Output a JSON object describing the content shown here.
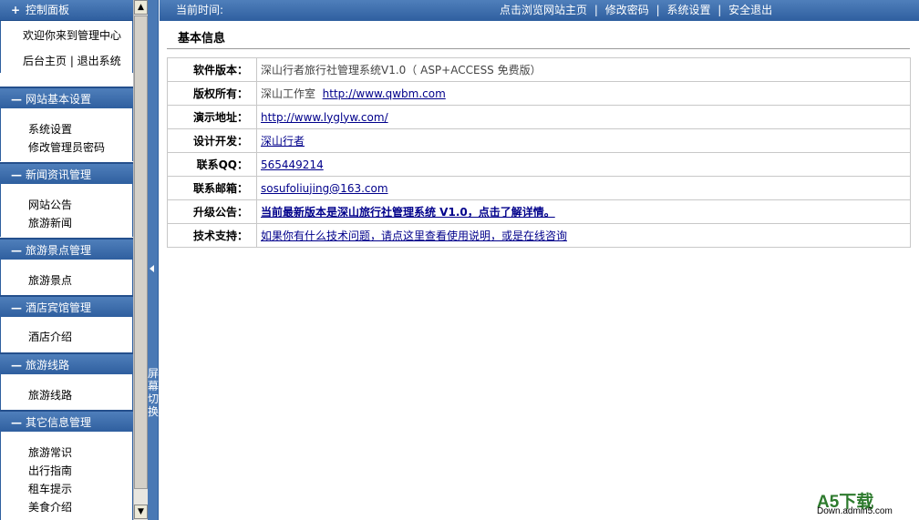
{
  "sidebar": {
    "control_panel": {
      "title": "控制面板",
      "icon": "plus-icon",
      "links": [
        "欢迎你来到管理中心",
        "后台主页 | 退出系统"
      ]
    },
    "sections": [
      {
        "title": "网站基本设置",
        "icon": "minus-icon",
        "items": [
          "系统设置",
          "修改管理员密码"
        ]
      },
      {
        "title": "新闻资讯管理",
        "icon": "minus-icon",
        "items": [
          "网站公告",
          "旅游新闻"
        ]
      },
      {
        "title": "旅游景点管理",
        "icon": "minus-icon",
        "items": [
          "旅游景点"
        ]
      },
      {
        "title": "酒店宾馆管理",
        "icon": "minus-icon",
        "items": [
          "酒店介绍"
        ]
      },
      {
        "title": "旅游线路",
        "icon": "minus-icon",
        "items": [
          "旅游线路"
        ]
      },
      {
        "title": "其它信息管理",
        "icon": "minus-icon",
        "items": [
          "旅游常识",
          "出行指南",
          "租车提示",
          "美食介绍"
        ]
      }
    ]
  },
  "splitter": {
    "label": [
      "屏",
      "幕",
      "切",
      "换"
    ],
    "icon": "collapse-left-arrow-icon"
  },
  "topbar": {
    "current_time": "当前时间:",
    "links": [
      "点击浏览网站主页",
      "修改密码",
      "系统设置",
      "安全退出"
    ],
    "separator": "|"
  },
  "main": {
    "title": "基本信息",
    "rows": [
      {
        "label": "软件版本：",
        "value": "深山行者旅行社管理系统V1.0（ ASP+ACCESS 免费版）"
      },
      {
        "label": "版权所有：",
        "value": "深山工作室",
        "link": "http://www.qwbm.com"
      },
      {
        "label": "演示地址：",
        "link": "http://www.lyglyw.com/"
      },
      {
        "label": "设计开发：",
        "link": "深山行者"
      },
      {
        "label": "联系QQ：",
        "link": "565449214"
      },
      {
        "label": "联系邮箱：",
        "link": "sosufoliujing@163.com"
      },
      {
        "label": "升级公告：",
        "link_bold": "当前最新版本是深山旅行社管理系统 V1.0，点击了解详情。"
      },
      {
        "label": "技术支持：",
        "link": "如果你有什么技术问题，请点这里查看使用说明，或是在线咨询"
      }
    ]
  },
  "watermark": {
    "brand": "A5下载",
    "site": "Down.admin5.com"
  },
  "colors": {
    "header_blue": "#2f5f9f",
    "link": "#00008b",
    "watermark_green": "#2d7a2d"
  }
}
